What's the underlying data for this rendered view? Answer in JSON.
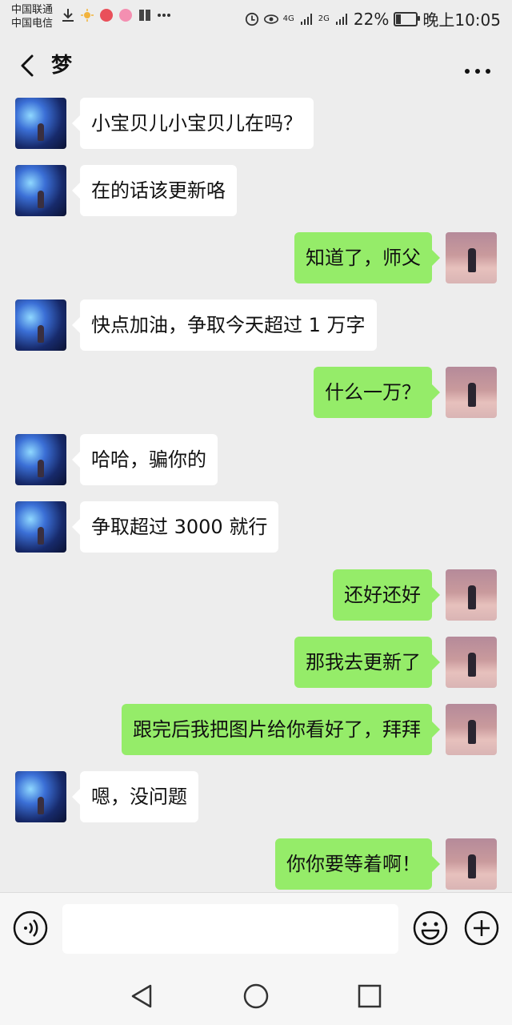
{
  "status_bar": {
    "carrier_1": "中国联通",
    "carrier_2": "中国电信",
    "network_1": "4G",
    "network_2": "2G",
    "battery": "22%",
    "time": "晚上10:05"
  },
  "header": {
    "title": "梦"
  },
  "messages": [
    {
      "side": "left",
      "text": "小宝贝儿小宝贝儿在吗？"
    },
    {
      "side": "left",
      "text": "在的话该更新咯"
    },
    {
      "side": "right",
      "text": "知道了，师父"
    },
    {
      "side": "left",
      "text": "快点加油，争取今天超过 1 万字"
    },
    {
      "side": "right",
      "text": "什么一万？"
    },
    {
      "side": "left",
      "text": "哈哈，骗你的"
    },
    {
      "side": "left",
      "text": "争取超过 3000 就行"
    },
    {
      "side": "right",
      "text": "还好还好"
    },
    {
      "side": "right",
      "text": "那我去更新了"
    },
    {
      "side": "right",
      "text": "跟完后我把图片给你看好了，拜拜"
    },
    {
      "side": "left",
      "text": "嗯，没问题"
    },
    {
      "side": "right",
      "text": "你你要等着啊！"
    }
  ],
  "input": {
    "value": "",
    "placeholder": ""
  },
  "colors": {
    "background": "#ededed",
    "bubble_sent": "#95ec69",
    "bubble_received": "#ffffff"
  },
  "icons": [
    "back-icon",
    "more-icon",
    "voice-icon",
    "emoji-icon",
    "plus-icon",
    "nav-back-icon",
    "nav-home-icon",
    "nav-recent-icon"
  ]
}
